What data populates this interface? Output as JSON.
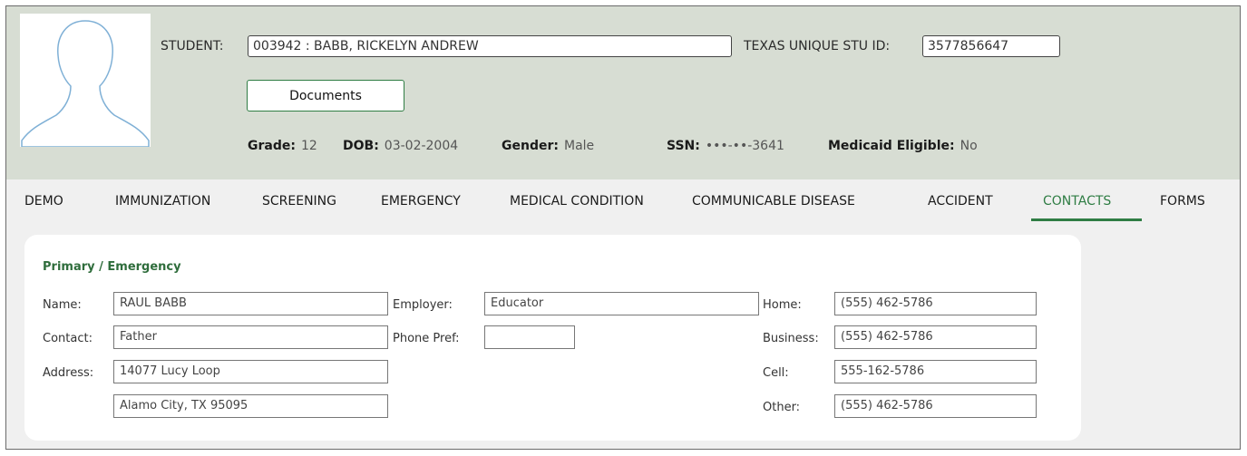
{
  "student": {
    "label": "STUDENT:",
    "value": "003942 : BABB, RICKELYN ANDREW",
    "texas_id_label": "TEXAS UNIQUE STU ID:",
    "texas_id_value": "3577856647",
    "documents_button": "Documents",
    "grade_label": "Grade:",
    "grade_value": "12",
    "dob_label": "DOB:",
    "dob_value": "03-02-2004",
    "gender_label": "Gender:",
    "gender_value": "Male",
    "ssn_label": "SSN:",
    "ssn_value": "•••-••-3641",
    "medicaid_label": "Medicaid Eligible:",
    "medicaid_value": "No"
  },
  "tabs": [
    {
      "label": "DEMO"
    },
    {
      "label": "IMMUNIZATION"
    },
    {
      "label": "SCREENING"
    },
    {
      "label": "EMERGENCY"
    },
    {
      "label": "MEDICAL CONDITION"
    },
    {
      "label": "COMMUNICABLE DISEASE"
    },
    {
      "label": "ACCIDENT"
    },
    {
      "label": "CONTACTS",
      "active": true
    },
    {
      "label": "FORMS"
    }
  ],
  "contact": {
    "section_title": "Primary / Emergency",
    "name_label": "Name:",
    "name_value": "RAUL BABB",
    "contact_label": "Contact:",
    "contact_value": "Father",
    "address_label": "Address:",
    "address_line1": "14077 Lucy Loop",
    "address_line2": "Alamo City, TX 95095",
    "employer_label": "Employer:",
    "employer_value": "Educator",
    "phone_pref_label": "Phone Pref:",
    "phone_pref_value": "",
    "home_label": "Home:",
    "home_value": "(555) 462-5786",
    "business_label": "Business:",
    "business_value": "(555) 462-5786",
    "cell_label": "Cell:",
    "cell_value": "555-162-5786",
    "other_label": "Other:",
    "other_value": "(555) 462-5786"
  },
  "colors": {
    "header_bg": "#d7ddd3",
    "accent_green": "#2f7d44",
    "avatar_outline": "#7fb0d6"
  },
  "icons": {
    "avatar": "person-silhouette-icon"
  }
}
